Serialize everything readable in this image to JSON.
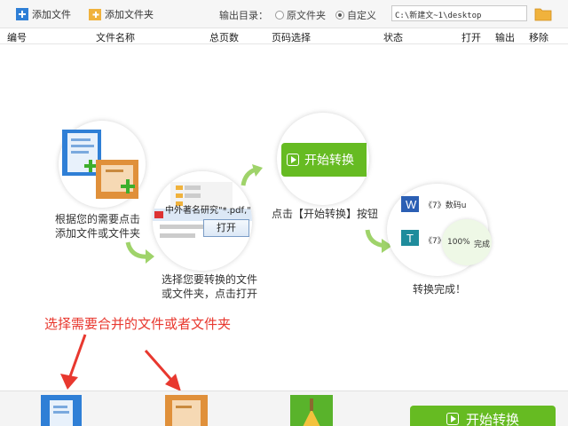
{
  "toolbar": {
    "add_file": "添加文件",
    "add_folder": "添加文件夹",
    "output_label": "输出目录：",
    "radio_original": "原文件夹",
    "radio_custom": "自定义",
    "output_path": "C:\\新建文~1\\desktop"
  },
  "columns": {
    "num": "编号",
    "name": "文件名称",
    "pages": "总页数",
    "page_select": "页码选择",
    "status": "状态",
    "open": "打开",
    "output": "输出",
    "remove": "移除"
  },
  "steps": {
    "step1": "根据您的需要点击\n添加文件或文件夹",
    "step2": "选择您要转换的文件\n或文件夹，点击打开",
    "step3": "点击【开始转换】按钮",
    "step4": "转换完成！",
    "green_btn": "开始转换",
    "dialog_file": "中外著名研究\"*.pdf,\"",
    "dialog_open": "打开",
    "done_item1": "《7》数码u",
    "done_item2": "《7》",
    "done_progress": "100%",
    "done_status": "完成"
  },
  "annotation": "选择需要合并的文件或者文件夹",
  "bottom": {
    "start": "开始转换"
  },
  "colors": {
    "green": "#66bb22",
    "red": "#e8382f",
    "blue": "#2f7fd6",
    "orange": "#f0a33c"
  }
}
